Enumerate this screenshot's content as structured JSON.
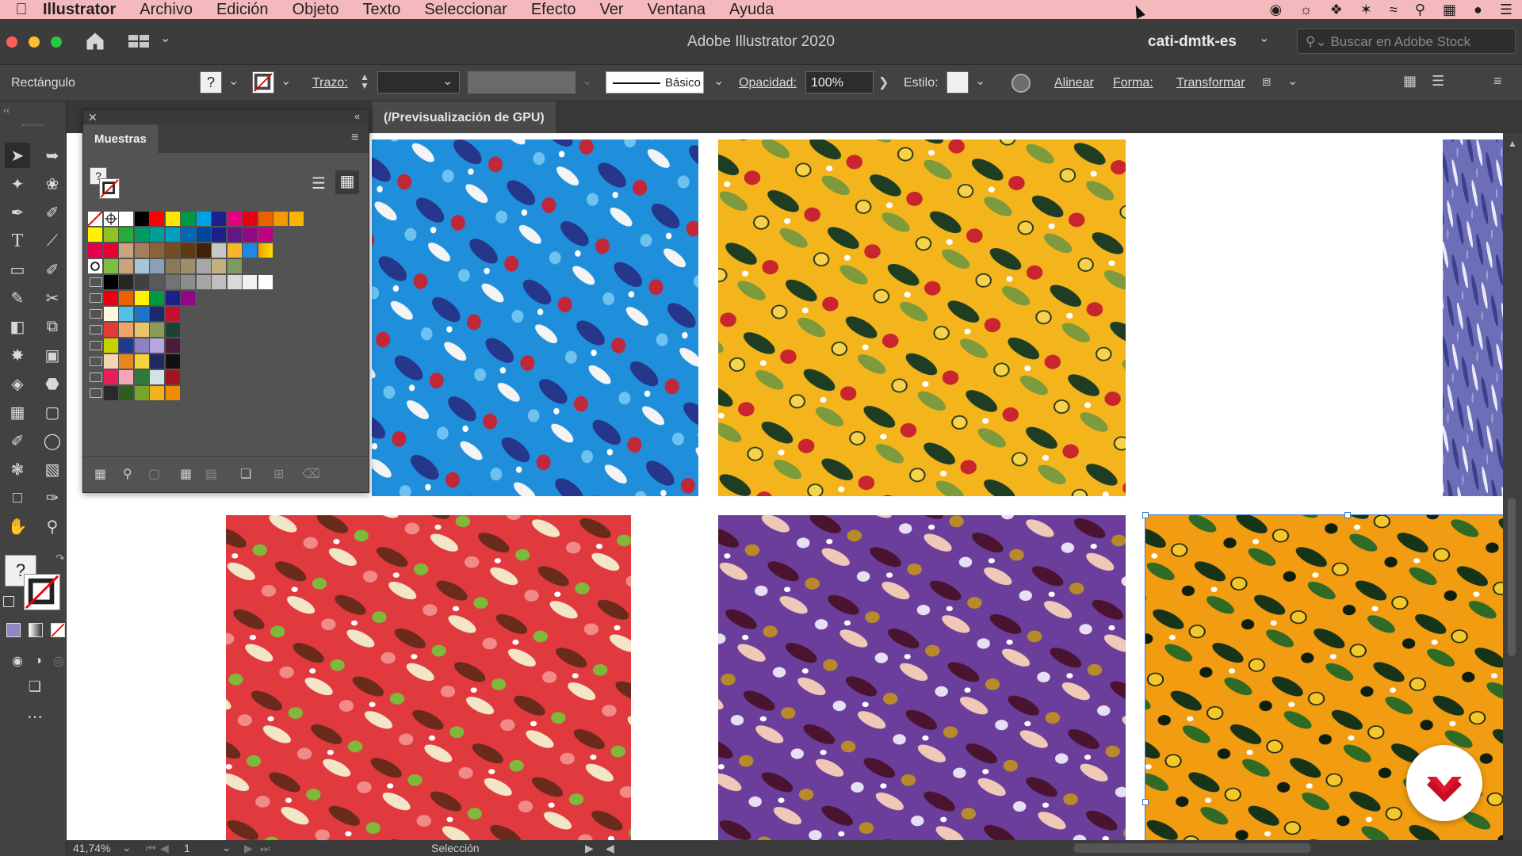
{
  "menubar": {
    "app": "Illustrator",
    "items": [
      "Archivo",
      "Edición",
      "Objeto",
      "Texto",
      "Seleccionar",
      "Efecto",
      "Ver",
      "Ventana",
      "Ayuda"
    ]
  },
  "window": {
    "title": "Adobe Illustrator 2020",
    "workspace": "cati-dmtk-es",
    "stock_search_placeholder": "Buscar en Adobe Stock"
  },
  "control": {
    "selection_type": "Rectángulo",
    "stroke_label": "Trazo:",
    "brush_label": "Básico",
    "opacity_label": "Opacidad:",
    "opacity_value": "100%",
    "style_label": "Estilo:",
    "align_label": "Alinear",
    "shape_label": "Forma:",
    "transform_label": "Transformar"
  },
  "document": {
    "tab_label": "(/Previsualización de GPU)"
  },
  "swatches_panel": {
    "title": "Muestras",
    "row1": [
      "#ffffff",
      "#000000",
      "#ff0000",
      "#ffe600",
      "#009944",
      "#00a0e9",
      "#1d2088",
      "#e4007f",
      "#e60012",
      "#eb6100",
      "#f39800",
      "#f8b500"
    ],
    "row2": [
      "#fff100",
      "#8fc31f",
      "#22ac38",
      "#009b63",
      "#009e96",
      "#00a0c1",
      "#0068b7",
      "#00479d",
      "#1d2088",
      "#601986",
      "#920783",
      "#be0081"
    ],
    "row3": [
      "#e5004f",
      "#e60033",
      "#c9a47c",
      "#a57e5b",
      "#8c6239",
      "#754c24",
      "#603813",
      "#42210b",
      "#c7c7c7",
      "#f8b62b",
      "#1e88e5"
    ],
    "row4": [
      "#7fbf3f",
      "#c9a47c",
      "#a7c5d8",
      "#8aa0b8",
      "#8a7a5a",
      "#9b8f6a",
      "#a8a8a8",
      "#c4b07c",
      "#7d9a62"
    ],
    "group1": [
      "#000000",
      "#262626",
      "#404040",
      "#595959",
      "#737373",
      "#8c8c8c",
      "#a6a6a6",
      "#bfbfbf",
      "#d9d9d9",
      "#f2f2f2",
      "#ffffff"
    ],
    "group2": [
      "#e60012",
      "#eb6100",
      "#fff100",
      "#009944",
      "#1d2088",
      "#920783"
    ],
    "group3": [
      "#fff6e0",
      "#4fc1e9",
      "#1e74c8",
      "#1b2a6b",
      "#c8102e"
    ],
    "group4": [
      "#e53935",
      "#f4a261",
      "#e9c46a",
      "#8a9a5b",
      "#1b4332"
    ],
    "group5": [
      "#c5d200",
      "#1e3a8a",
      "#8e82c4",
      "#b6a6e0",
      "#4a1c3a"
    ],
    "group6": [
      "#f6d6b0",
      "#e8871e",
      "#f6d33d",
      "#1d2a5e",
      "#111111"
    ],
    "group7": [
      "#e81f5b",
      "#f4a6b8",
      "#2d7a3a",
      "#cfe3e8",
      "#a31621"
    ],
    "group8": [
      "#2a2a2a",
      "#2e5e1e",
      "#7aa32a",
      "#f2b21d",
      "#f08c00"
    ]
  },
  "statusbar": {
    "zoom": "41,74%",
    "artboard": "1",
    "tool_label": "Selección"
  }
}
